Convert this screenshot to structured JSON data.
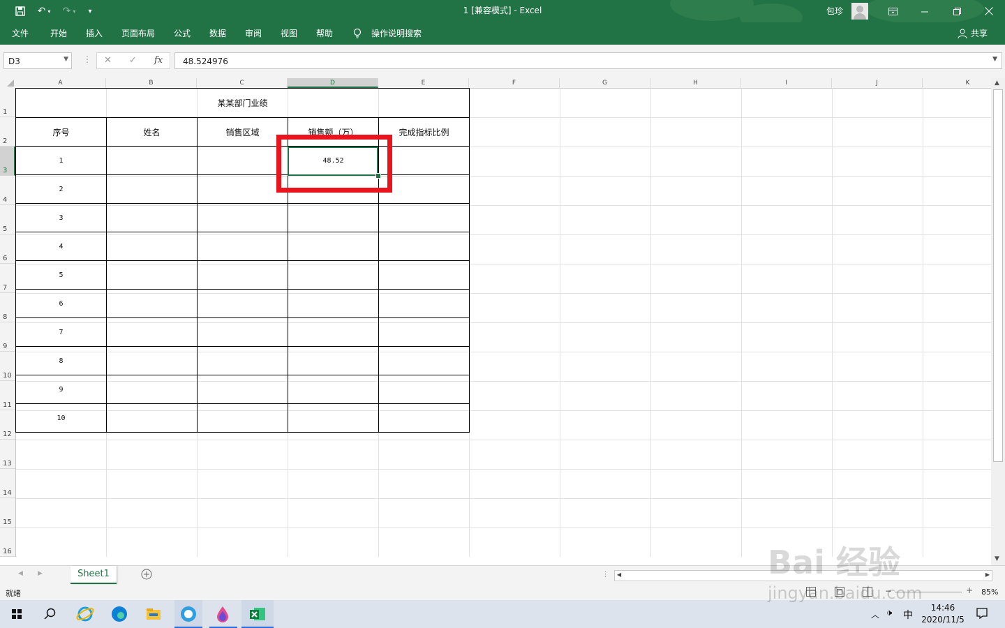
{
  "window": {
    "title": "1  [兼容模式]  -  Excel",
    "user": "包珍"
  },
  "ribbon": {
    "tabs": [
      "文件",
      "开始",
      "插入",
      "页面布局",
      "公式",
      "数据",
      "审阅",
      "视图",
      "帮助"
    ],
    "tell_me": "操作说明搜索",
    "share": "共享"
  },
  "formula_bar": {
    "name_box": "D3",
    "formula": "48.524976"
  },
  "grid": {
    "columns": [
      "A",
      "B",
      "C",
      "D",
      "E",
      "F",
      "G",
      "H",
      "I",
      "J",
      "K"
    ],
    "rows": [
      "1",
      "2",
      "3",
      "4",
      "5",
      "6",
      "7",
      "8",
      "9",
      "10",
      "11",
      "12",
      "13",
      "14",
      "15",
      "16"
    ],
    "selected_column": "D",
    "selected_row": "3"
  },
  "table": {
    "title": "某某部门业绩",
    "headers": [
      "序号",
      "姓名",
      "销售区域",
      "销售额（万）",
      "完成指标比例"
    ],
    "rows": [
      [
        "1",
        "",
        "",
        "48.52",
        ""
      ],
      [
        "2",
        "",
        "",
        "",
        ""
      ],
      [
        "3",
        "",
        "",
        "",
        ""
      ],
      [
        "4",
        "",
        "",
        "",
        ""
      ],
      [
        "5",
        "",
        "",
        "",
        ""
      ],
      [
        "6",
        "",
        "",
        "",
        ""
      ],
      [
        "7",
        "",
        "",
        "",
        ""
      ],
      [
        "8",
        "",
        "",
        "",
        ""
      ],
      [
        "9",
        "",
        "",
        "",
        ""
      ],
      [
        "10",
        "",
        "",
        "",
        ""
      ]
    ]
  },
  "sheets": {
    "active": "Sheet1"
  },
  "status": {
    "text": "就绪",
    "zoom": "85%"
  },
  "taskbar": {
    "time": "14:46",
    "date": "2020/11/5",
    "ime": "中"
  },
  "watermark": {
    "line1": "Bai 经验",
    "line2": "jingyan.baidu.com"
  },
  "colors": {
    "accent": "#217346",
    "highlight": "#e8141e"
  }
}
